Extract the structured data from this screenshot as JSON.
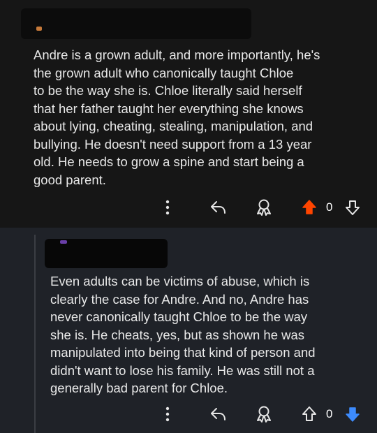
{
  "comments": [
    {
      "body": "Andre is a grown adult, and more importantly, he's\nthe grown adult who canonically taught Chloe\nto be the way she is. Chloe literally said herself\nthat her father taught her everything she knows\nabout lying, cheating, stealing, manipulation, and\nbullying. He doesn't need support from a 13 year\nold. He needs to grow a spine and start being a\ngood parent.",
      "score": "0",
      "vote_state": "upvoted",
      "vote_color": "#ff4500"
    },
    {
      "body": "Even adults can be victims of abuse, which is\nclearly the case for Andre. And no, Andre has\nnever canonically taught Chloe to be the way\nshe is. He cheats, yes, but as shown he was\nmanipulated into being that kind of person and\ndidn't want to lose his family. He was still not a\ngenerally bad parent for Chloe.",
      "score": "0",
      "vote_state": "downvoted",
      "vote_color": "#3d8bfd"
    }
  ],
  "icons": [
    "more-options-icon",
    "reply-icon",
    "award-icon",
    "upvote-icon",
    "downvote-icon"
  ]
}
